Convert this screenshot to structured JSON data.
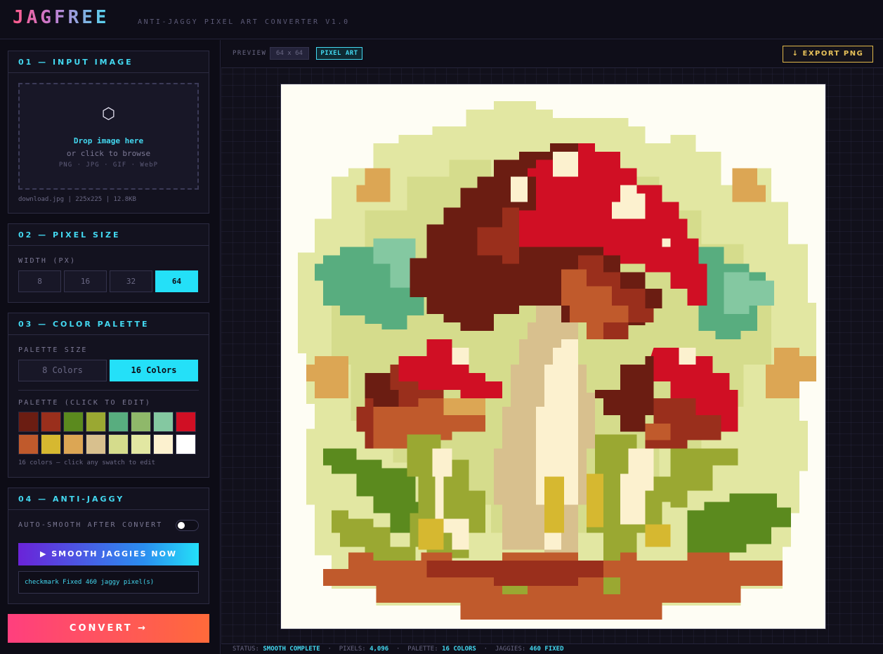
{
  "app": {
    "logo": "JAGFREE",
    "subtitle": "ANTI-JAGGY PIXEL ART CONVERTER V1.0"
  },
  "input_panel": {
    "title": "01 — INPUT IMAGE",
    "dropzone_icon": "hexagon-icon",
    "drop_text": "Drop image here",
    "browse_text": "or click to browse",
    "formats": "PNG · JPG · GIF · WebP",
    "file_info": "download.jpg | 225x225 | 12.8KB"
  },
  "pixel_size_panel": {
    "title": "02 — PIXEL SIZE",
    "label": "WIDTH (PX)",
    "options": [
      "8",
      "16",
      "32",
      "64"
    ],
    "selected": "64"
  },
  "palette_panel": {
    "title": "03 — COLOR PALETTE",
    "size_label": "PALETTE SIZE",
    "size_options": [
      "8 Colors",
      "16 Colors"
    ],
    "selected_size": "16 Colors",
    "edit_label": "PALETTE (CLICK TO EDIT)",
    "colors": [
      "#6b1d12",
      "#9a2f1c",
      "#5b8a1e",
      "#9aa832",
      "#58ad7f",
      "#8fb86a",
      "#84c8a1",
      "#d00f24",
      "#c05a2c",
      "#d6b830",
      "#dca654",
      "#d8c08e",
      "#d5dc8c",
      "#e2e7a2",
      "#fcf1cf",
      "#ffffff"
    ],
    "note": "16 colors — click any swatch to edit"
  },
  "anti_jaggy_panel": {
    "title": "04 — ANTI-JAGGY",
    "auto_smooth_label": "AUTO-SMOOTH AFTER CONVERT",
    "auto_smooth_on": false,
    "smooth_button": "▶ SMOOTH JAGGIES NOW",
    "log": "checkmark Fixed 460 jaggy pixel(s)"
  },
  "convert_button": "CONVERT →",
  "toolbar": {
    "preview_label": "PREVIEW",
    "dimensions": "64 x 64",
    "mode_badge": "PIXEL ART",
    "export_button": "↓ EXPORT PNG"
  },
  "canvas": {
    "image_name": "mushroom-pixel-art"
  },
  "status": {
    "status_label": "STATUS:",
    "status_value": "SMOOTH COMPLETE",
    "pixels_label": "PIXELS:",
    "pixels_value": "4,096",
    "palette_label": "PALETTE:",
    "palette_value": "16 COLORS",
    "jaggies_label": "JAGGIES:",
    "jaggies_value": "460 FIXED"
  }
}
